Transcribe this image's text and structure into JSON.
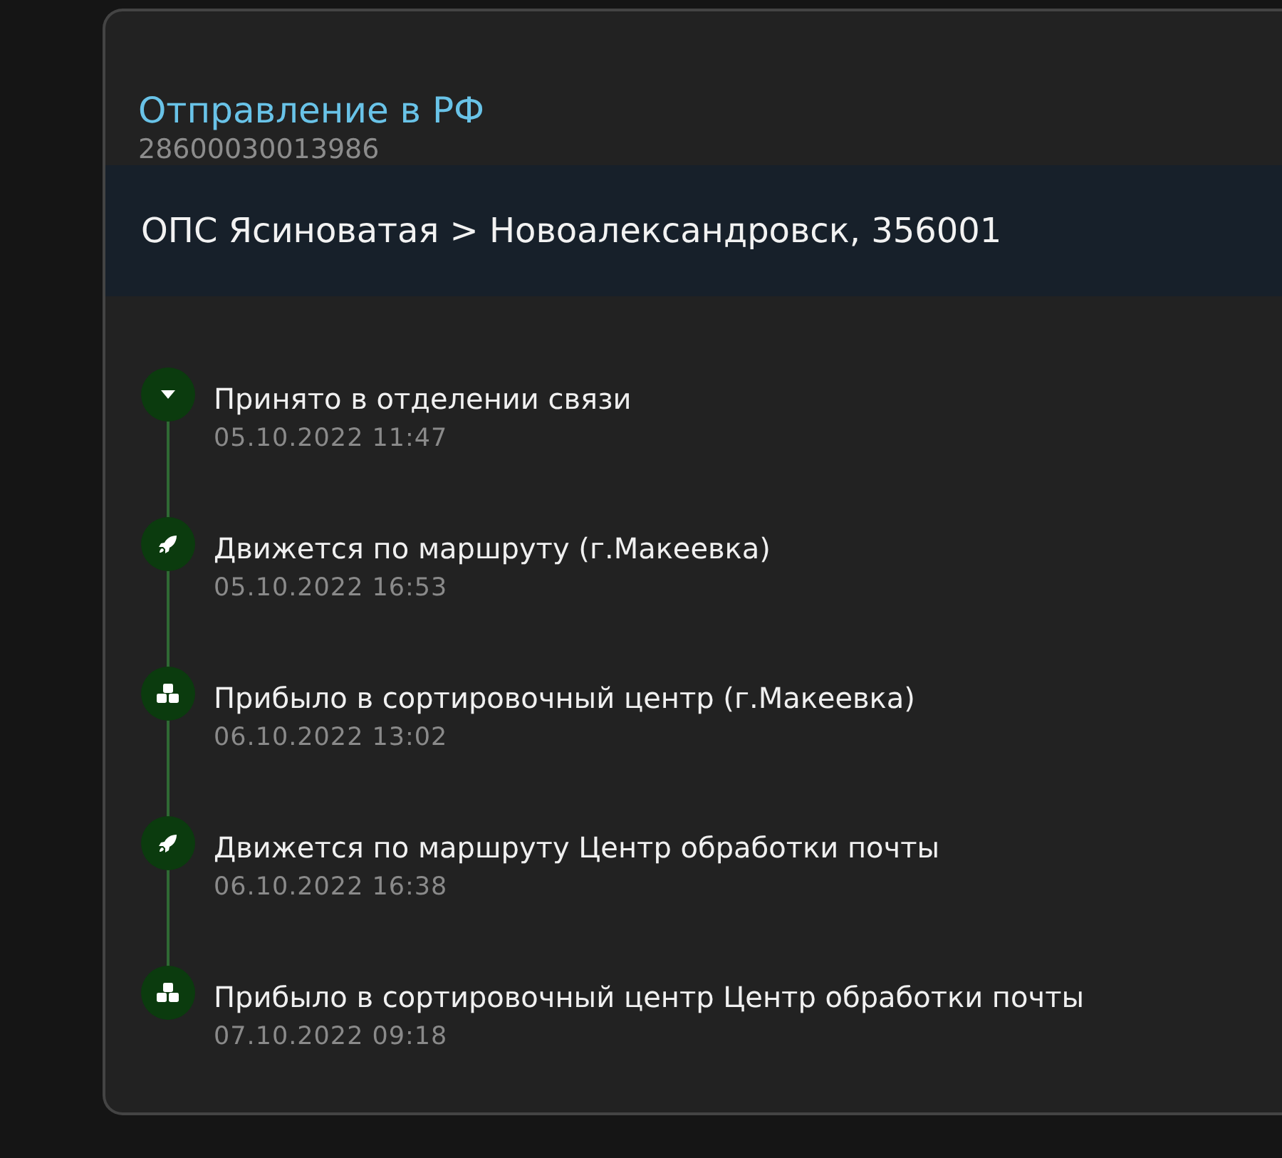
{
  "shipment": {
    "title": "Отправление в РФ",
    "tracking_number": "28600030013986",
    "route": "ОПС Ясиноватая > Новоалександровск, 356001"
  },
  "events": [
    {
      "kind": "accepted",
      "status": "Принято в отделении связи",
      "datetime": "05.10.2022 11:47"
    },
    {
      "kind": "moving",
      "status": "Движется по маршруту (г.Макеевка)",
      "datetime": "05.10.2022 16:53"
    },
    {
      "kind": "arrived",
      "status": "Прибыло в сортировочный центр (г.Макеевка)",
      "datetime": "06.10.2022 13:02"
    },
    {
      "kind": "moving",
      "status": "Движется по маршруту Центр обработки почты",
      "datetime": "06.10.2022 16:38"
    },
    {
      "kind": "arrived",
      "status": "Прибыло в сортировочный центр Центр обработки почты",
      "datetime": "07.10.2022 09:18"
    }
  ]
}
